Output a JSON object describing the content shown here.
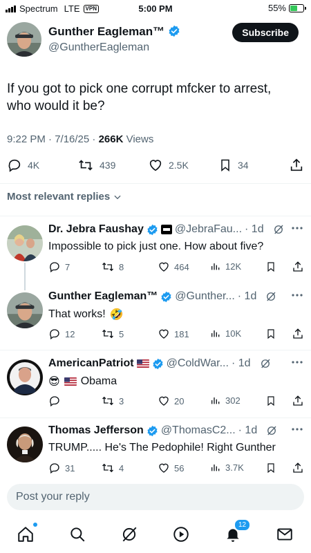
{
  "status_bar": {
    "carrier": "Spectrum",
    "network": "LTE",
    "vpn": "VPN",
    "time": "5:00 PM",
    "battery": "55%",
    "battery_level": 0.55
  },
  "tweet": {
    "author": "Gunther Eagleman™",
    "handle": "@GuntherEagleman",
    "subscribe_label": "Subscribe",
    "text": "If you got to pick one corrupt mfcker to arrest, who would it be?",
    "timestamp": "9:22 PM · 7/16/25 · ",
    "views_count": "266K",
    "views_label": " Views",
    "stats": {
      "replies": "4K",
      "retweets": "439",
      "likes": "2.5K",
      "bookmarks": "34"
    }
  },
  "replies_filter": "Most relevant replies",
  "replies": [
    {
      "name": "Dr. Jebra Faushay",
      "handle": "@JebraFau...",
      "time": "· 1d",
      "text": "Impossible to pick just one. How about five?",
      "replies": "7",
      "retweets": "8",
      "likes": "464",
      "views": "12K"
    },
    {
      "name": "Gunther Eagleman™",
      "handle": "@Gunther...",
      "time": "· 1d",
      "text": "That works!",
      "emoji": "🤣",
      "replies": "12",
      "retweets": "5",
      "likes": "181",
      "views": "10K"
    },
    {
      "name": "AmericanPatriot",
      "handle": "@ColdWar...",
      "time": "· 1d",
      "emoji": "😎",
      "text": "Obama",
      "replies": "",
      "retweets": "3",
      "likes": "20",
      "views": "302"
    },
    {
      "name": "Thomas Jefferson",
      "handle": "@ThomasC2...",
      "time": "· 1d",
      "text": "TRUMP..... He's The Pedophile! Right Gunther",
      "replies": "31",
      "retweets": "4",
      "likes": "56",
      "views": "3.7K"
    }
  ],
  "reply_box": {
    "placeholder": "Post your reply"
  },
  "nav": {
    "notifications_badge": "12"
  },
  "colors": {
    "accent": "#1d9bf0",
    "text": "#0f1419",
    "muted": "#536471",
    "battery": "#34c759"
  }
}
